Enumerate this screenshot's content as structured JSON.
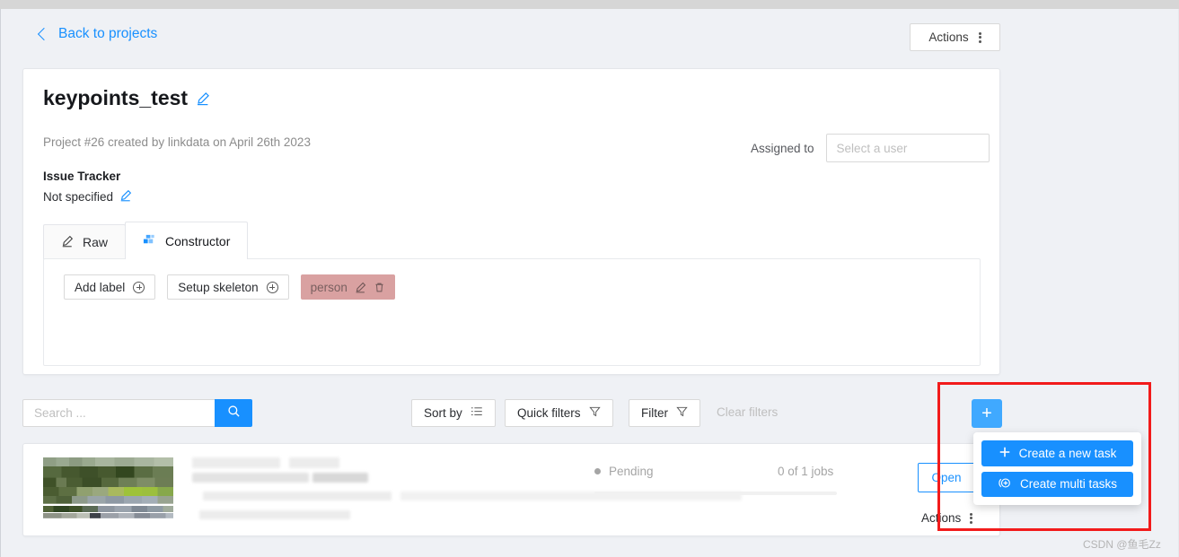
{
  "header": {
    "back_label": "Back to projects",
    "actions_label": "Actions"
  },
  "project": {
    "title": "keypoints_test",
    "meta": "Project #26 created by linkdata on April 26th 2023",
    "issue_tracker_label": "Issue Tracker",
    "issue_tracker_value": "Not specified",
    "assigned_to_label": "Assigned to",
    "assignee_placeholder": "Select a user",
    "assignee_value": ""
  },
  "tabs": [
    {
      "label": "Raw",
      "icon": "pencil-icon",
      "active": false
    },
    {
      "label": "Constructor",
      "icon": "blocks-icon",
      "active": true
    }
  ],
  "labels_panel": {
    "add_label": "Add label",
    "setup_skeleton": "Setup skeleton",
    "labels": [
      {
        "name": "person",
        "color": "#d9a1a1"
      }
    ]
  },
  "filter_bar": {
    "search_placeholder": "Search ...",
    "search_value": "",
    "search_icon": "search-icon",
    "sort_by": "Sort by",
    "quick_filters": "Quick filters",
    "filter": "Filter",
    "clear_filters": "Clear filters"
  },
  "create_menu": {
    "plus_label": "+",
    "items": [
      {
        "label": "Create a new task",
        "icon": "plus-icon"
      },
      {
        "label": "Create multi tasks",
        "icon": "plus-circle-icon"
      }
    ]
  },
  "task": {
    "status": "Pending",
    "jobs": "0 of 1 jobs",
    "progress_percent": 0,
    "open_label": "Open",
    "actions_label": "Actions"
  },
  "watermark": "CSDN @鱼毛Zz",
  "colors": {
    "accent": "#1890ff",
    "accent_light": "#40a9ff",
    "page_bg": "#eff1f5",
    "highlight_box": "#f21b1b",
    "label_person": "#d9a1a1"
  }
}
